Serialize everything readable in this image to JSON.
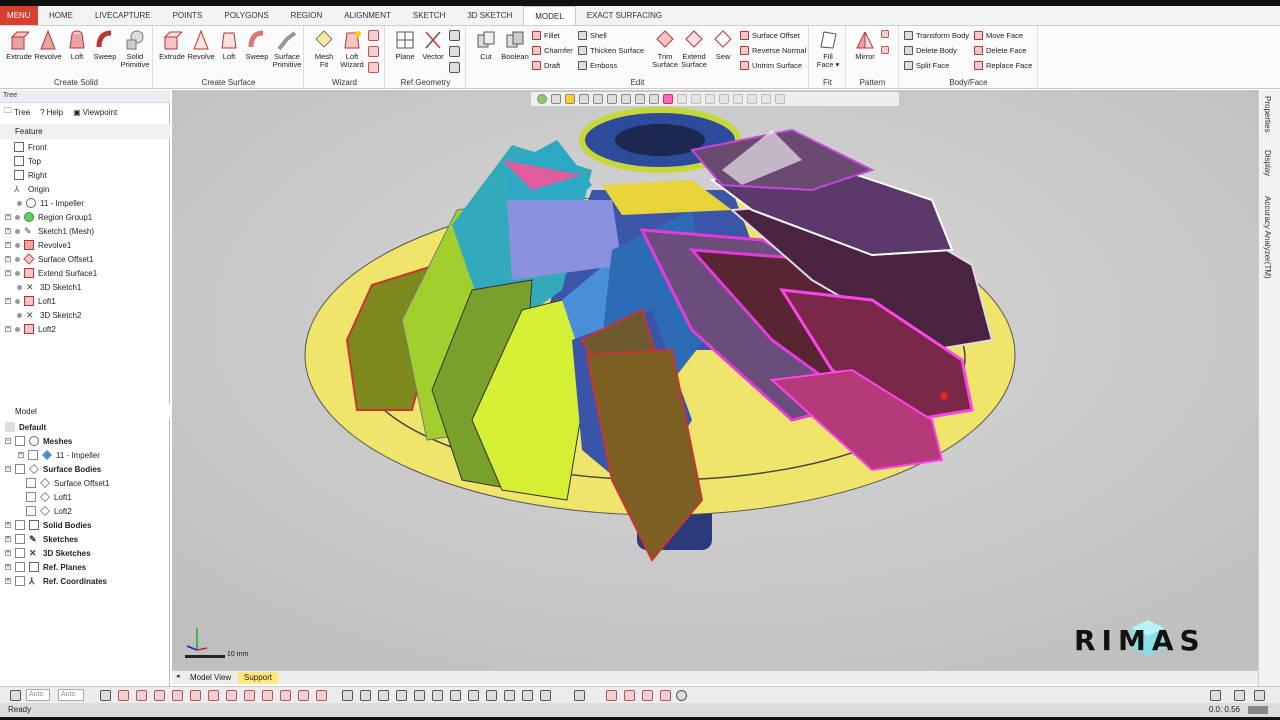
{
  "tabs": {
    "menu": "MENU",
    "items": [
      "HOME",
      "LIVECAPTURE",
      "POINTS",
      "POLYGONS",
      "REGION",
      "ALIGNMENT",
      "SKETCH",
      "3D SKETCH",
      "MODEL",
      "EXACT SURFACING"
    ],
    "active": "MODEL"
  },
  "ribbon": {
    "create_solid": {
      "title": "Create Solid",
      "buttons": [
        "Extrude",
        "Revolve",
        "Loft",
        "Sweep",
        "Solid\nPrimitive"
      ]
    },
    "create_surface": {
      "title": "Create Surface",
      "buttons": [
        "Extrude",
        "Revolve",
        "Loft",
        "Sweep",
        "Surface\nPrimitive"
      ]
    },
    "wizard": {
      "title": "Wizard",
      "buttons": [
        "Mesh\nFit",
        "Loft\nWizard"
      ]
    },
    "ref_geometry": {
      "title": "Ref.Geometry",
      "buttons": [
        "Plane",
        "Vector"
      ]
    },
    "edit": {
      "title": "Edit",
      "big": [
        "Cut",
        "Boolean"
      ],
      "small": [
        "Fillet",
        "Chamfer",
        "Draft",
        "Shell",
        "Thicken Surface",
        "Emboss"
      ],
      "big2": [
        "Trim\nSurface",
        "Extend\nSurface",
        "Sew"
      ],
      "small2": [
        "Surface Offset",
        "Reverse Normal",
        "Untrim Surface"
      ]
    },
    "fit": {
      "title": "Fit",
      "buttons": [
        "Fill\nFace ▾"
      ]
    },
    "pattern": {
      "title": "Pattern",
      "buttons": [
        "Mirror"
      ]
    },
    "body_face": {
      "title": "Body/Face",
      "small": [
        "Transform Body",
        "Delete Body",
        "Split Face",
        "Move Face",
        "Delete Face",
        "Replace Face"
      ]
    }
  },
  "tree_panel": {
    "title": "Tree",
    "tabs": [
      "Tree",
      "Help",
      "Viewpoint"
    ],
    "feature_header": "Feature",
    "features": [
      "Front",
      "Top",
      "Right",
      "Origin",
      "11 - Impeller",
      "Region Group1",
      "Sketch1 (Mesh)",
      "Revolve1",
      "Surface Offset1",
      "Extend Surface1",
      "3D Sketch1",
      "Loft1",
      "3D Sketch2",
      "Loft2"
    ],
    "model_header": "Model",
    "model_default": "Default",
    "model_items": [
      "Meshes",
      "11 - Impeller",
      "Surface Bodies",
      "Surface Offset1",
      "Loft1",
      "Loft2",
      "Solid Bodies",
      "Sketches",
      "3D Sketches",
      "Ref. Planes",
      "Ref. Coordinates"
    ]
  },
  "viewport": {
    "scale_label": "10 mm",
    "logo_text": "RIMAS"
  },
  "bottom_tabs": [
    "Model View",
    "Support"
  ],
  "bottom_bar": {
    "auto1": "Auto",
    "auto2": "Auto"
  },
  "status": {
    "left": "Ready",
    "right": "0.0: 0.56"
  },
  "right_tabs": [
    "Properties",
    "Display",
    "Accuracy Analyzer(TM)"
  ]
}
